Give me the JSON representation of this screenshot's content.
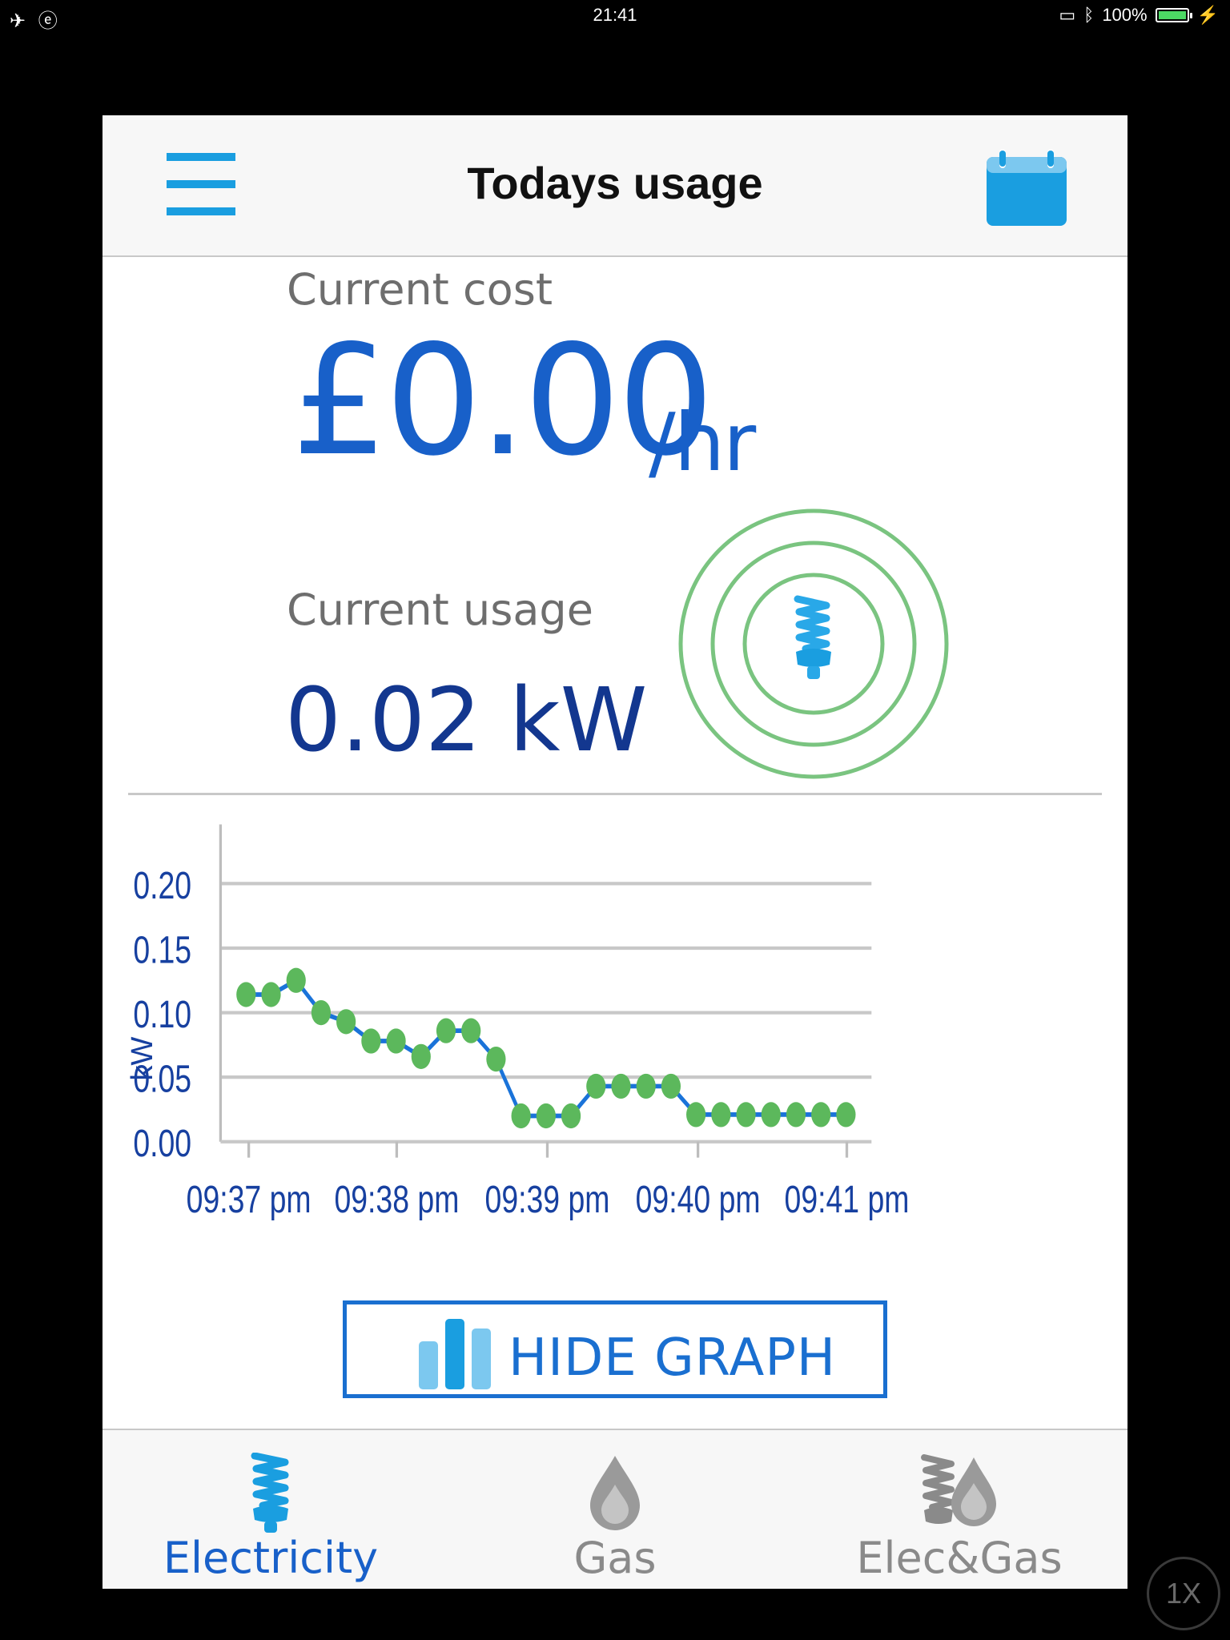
{
  "status_bar": {
    "time": "21:41",
    "battery": "100%"
  },
  "header": {
    "title": "Todays usage"
  },
  "cost": {
    "label": "Current cost",
    "value": "£0.00",
    "unit": "/hr"
  },
  "usage": {
    "label": "Current usage",
    "value": "0.02 kW"
  },
  "colors": {
    "accent": "#1860c9",
    "usage_blue": "#13378f",
    "ring_green": "#7ac480",
    "point_green": "#5cb85c",
    "line_blue": "#1a73d9"
  },
  "chart_data": {
    "type": "line",
    "ylabel": "kW",
    "ylim": [
      0,
      0.2
    ],
    "y_ticks": [
      "0.00",
      "0.05",
      "0.10",
      "0.15",
      "0.20"
    ],
    "x_ticks": [
      "09:37 pm",
      "09:38 pm",
      "09:39 pm",
      "09:40 pm",
      "09:41 pm"
    ],
    "grid": true,
    "series": [
      {
        "values": [
          0.114,
          0.114,
          0.125,
          0.1,
          0.093,
          0.078,
          0.078,
          0.066,
          0.086,
          0.086,
          0.064,
          0.02,
          0.02,
          0.02,
          0.043,
          0.043,
          0.043,
          0.043,
          0.021,
          0.021,
          0.021,
          0.021,
          0.021,
          0.021,
          0.021
        ]
      }
    ]
  },
  "graph_toggle": {
    "label": "HIDE GRAPH"
  },
  "tabs": [
    {
      "label": "Electricity",
      "icon": "bulb-icon",
      "active": true
    },
    {
      "label": "Gas",
      "icon": "flame-drop-icon",
      "active": false
    },
    {
      "label": "Elec&Gas",
      "icon": "bulb-and-drop-icon",
      "active": false
    }
  ],
  "overlay": {
    "zoom": "1X"
  }
}
